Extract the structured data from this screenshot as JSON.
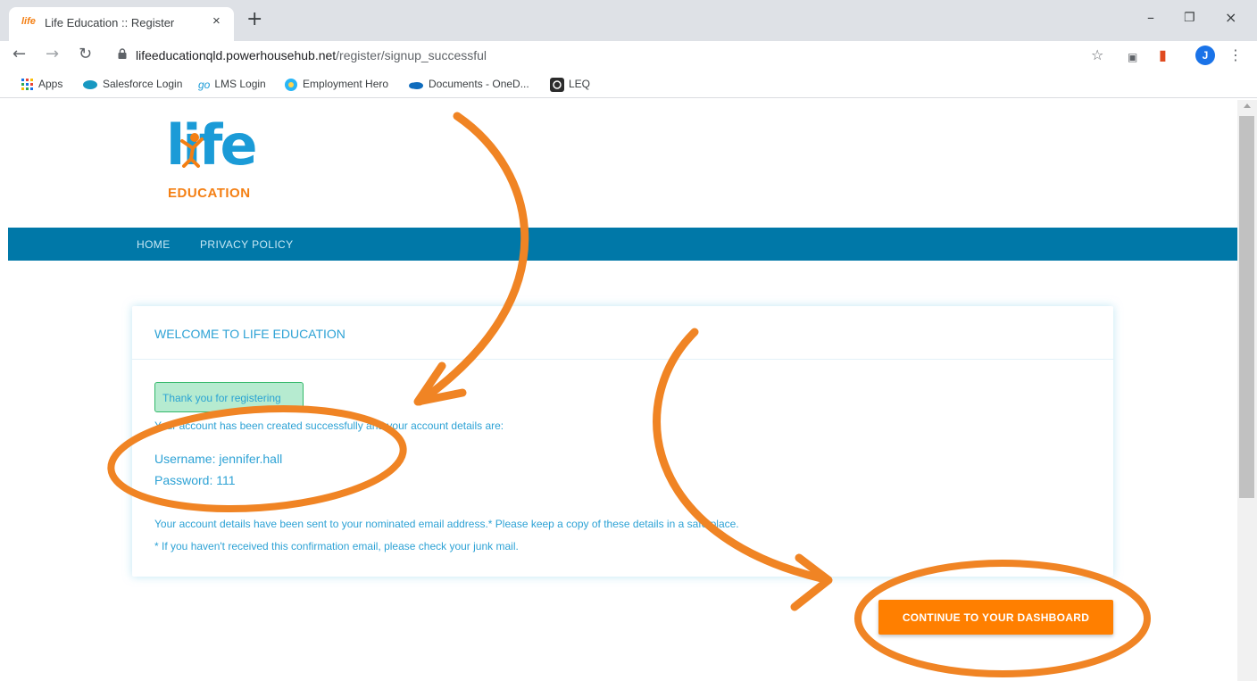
{
  "browser": {
    "tab_favicon": "life",
    "tab_title": "Life Education :: Register",
    "tab_close": "×",
    "new_tab": "+",
    "window_controls": [
      "–",
      "❐",
      "×"
    ],
    "url_host": "lifeeducationqld.powerhousehub.net",
    "url_path": "/register/signup_successful",
    "profile_initial": "J",
    "bookmarks": [
      {
        "label": "Apps",
        "icon": "apps-grid-icon"
      },
      {
        "label": "Salesforce Login",
        "icon": "salesforce-icon"
      },
      {
        "label": "LMS Login",
        "icon": "lms-icon"
      },
      {
        "label": "Employment Hero",
        "icon": "employment-hero-icon"
      },
      {
        "label": "Documents - OneD...",
        "icon": "onedrive-icon"
      },
      {
        "label": "LEQ",
        "icon": "leq-icon"
      }
    ]
  },
  "logo": {
    "word": "life",
    "sub": "EDUCATION"
  },
  "nav": {
    "home": "HOME",
    "privacy": "PRIVACY POLICY"
  },
  "card": {
    "title": "WELCOME TO LIFE EDUCATION",
    "alert": "Thank you for registering",
    "created": "Your account has been created successfully and your account details are:",
    "username": "Username: jennifer.hall",
    "password": "Password: 111",
    "sent": "Your account details have been sent to your nominated email address.* Please keep a copy of these details in a safe place.",
    "junk": "* If you haven't received this confirmation email, please check your junk mail."
  },
  "continue_button": "CONTINUE TO YOUR DASHBOARD",
  "colors": {
    "navbar": "#0078a8",
    "text_blue": "#2da2d5",
    "button_orange": "#ff7f00",
    "annotation_orange": "#f08424",
    "alert_bg": "#b6ebd0"
  }
}
